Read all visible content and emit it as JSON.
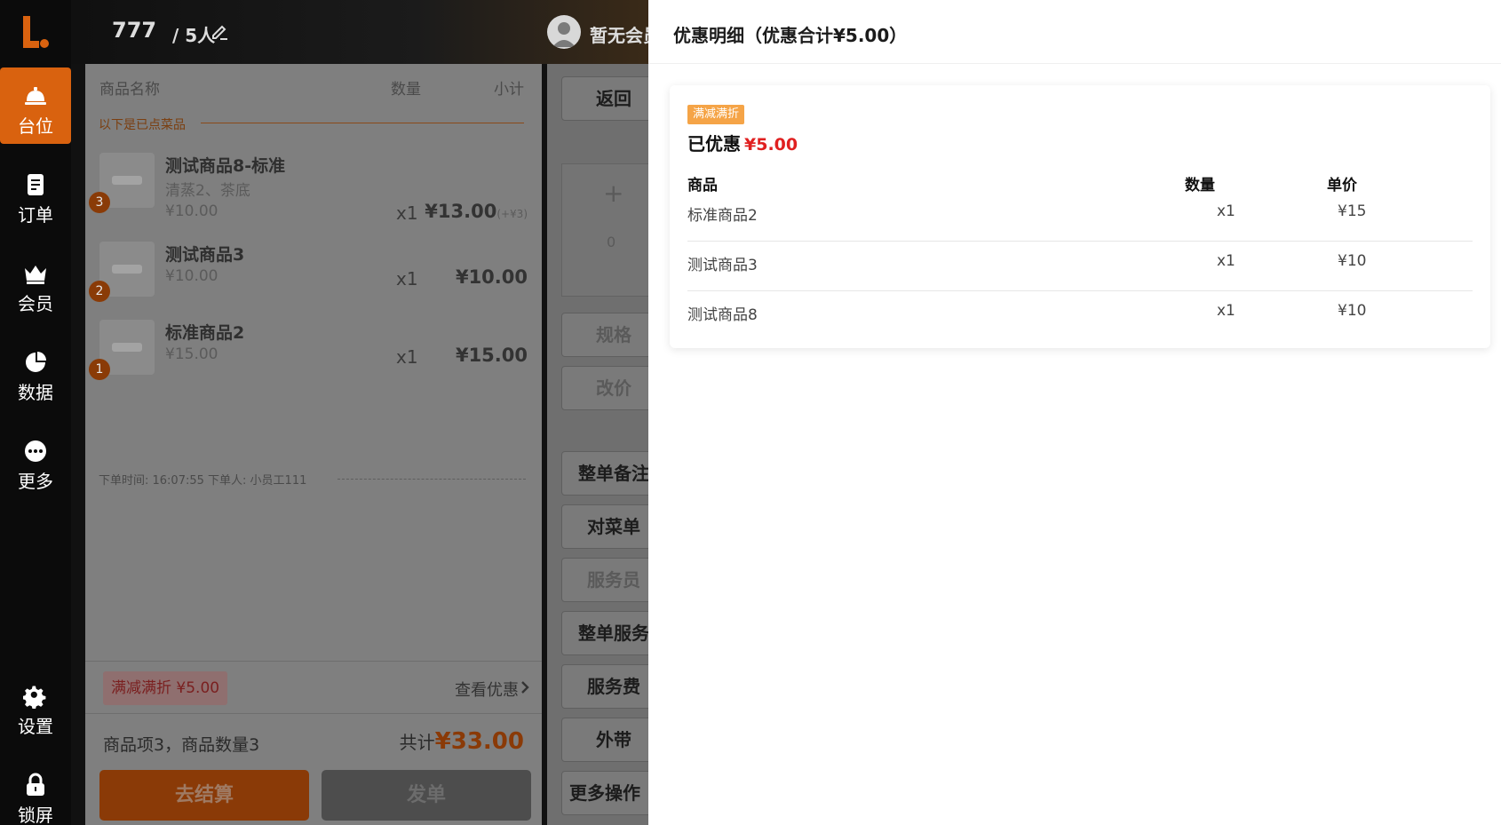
{
  "sidebar": {
    "items": [
      {
        "label": "台位",
        "icon": "table-bell-icon"
      },
      {
        "label": "订单",
        "icon": "order-doc-icon"
      },
      {
        "label": "会员",
        "icon": "member-crown-icon"
      },
      {
        "label": "数据",
        "icon": "pie-chart-icon"
      },
      {
        "label": "更多",
        "icon": "more-dots-icon"
      },
      {
        "label": "设置",
        "icon": "gear-icon"
      },
      {
        "label": "锁屏",
        "icon": "lock-icon"
      }
    ],
    "active_index": 0
  },
  "header": {
    "table_no": "777",
    "guests": "/ 5人",
    "member": "暂无会员"
  },
  "order": {
    "col_name": "商品名称",
    "col_qty": "数量",
    "col_subtotal": "小计",
    "section": "以下是已点菜品",
    "items": [
      {
        "badge": "3",
        "name": "测试商品8-标准",
        "sub": "清蒸2、茶底",
        "price": "¥10.00",
        "qty": "x1",
        "subtotal": "¥13.00",
        "extra": "(+¥3)"
      },
      {
        "badge": "2",
        "name": "测试商品3",
        "price": "¥10.00",
        "qty": "x1",
        "subtotal": "¥10.00"
      },
      {
        "badge": "1",
        "name": "标准商品2",
        "price": "¥15.00",
        "qty": "x1",
        "subtotal": "¥15.00"
      }
    ],
    "meta": "下单时间: 16:07:55    下单人: 小员工111",
    "promo_tag": "满减满折 ¥5.00",
    "view_promo": "查看优惠",
    "summary": "商品项3，商品数量3",
    "total_label": "共计",
    "total": "¥33.00",
    "pay_button": "去结算",
    "send_button": "发单"
  },
  "actions": {
    "back": "返回",
    "stepper_plus": "+",
    "stepper_value": "0",
    "spec": "规格",
    "reprice": "改价",
    "note": "整单备注",
    "check": "对菜单",
    "waiter": "服务员",
    "service": "整单服务",
    "fee": "服务费",
    "takeout": "外带",
    "more": "更多操作 >"
  },
  "drawer": {
    "title": "优惠明细（优惠合计¥5.00）",
    "tag": "满减满折",
    "saved_label": "已优惠",
    "saved_amount": "¥5.00",
    "headers": {
      "name": "商品",
      "qty": "数量",
      "price": "单价"
    },
    "rows": [
      {
        "name": "标准商品2",
        "qty": "x1",
        "price": "¥15"
      },
      {
        "name": "测试商品3",
        "qty": "x1",
        "price": "¥10"
      },
      {
        "name": "测试商品8",
        "qty": "x1",
        "price": "¥10"
      }
    ]
  },
  "colors": {
    "accent": "#d9620f",
    "discount_red": "#e02020",
    "tag_orange": "#f5a447"
  }
}
